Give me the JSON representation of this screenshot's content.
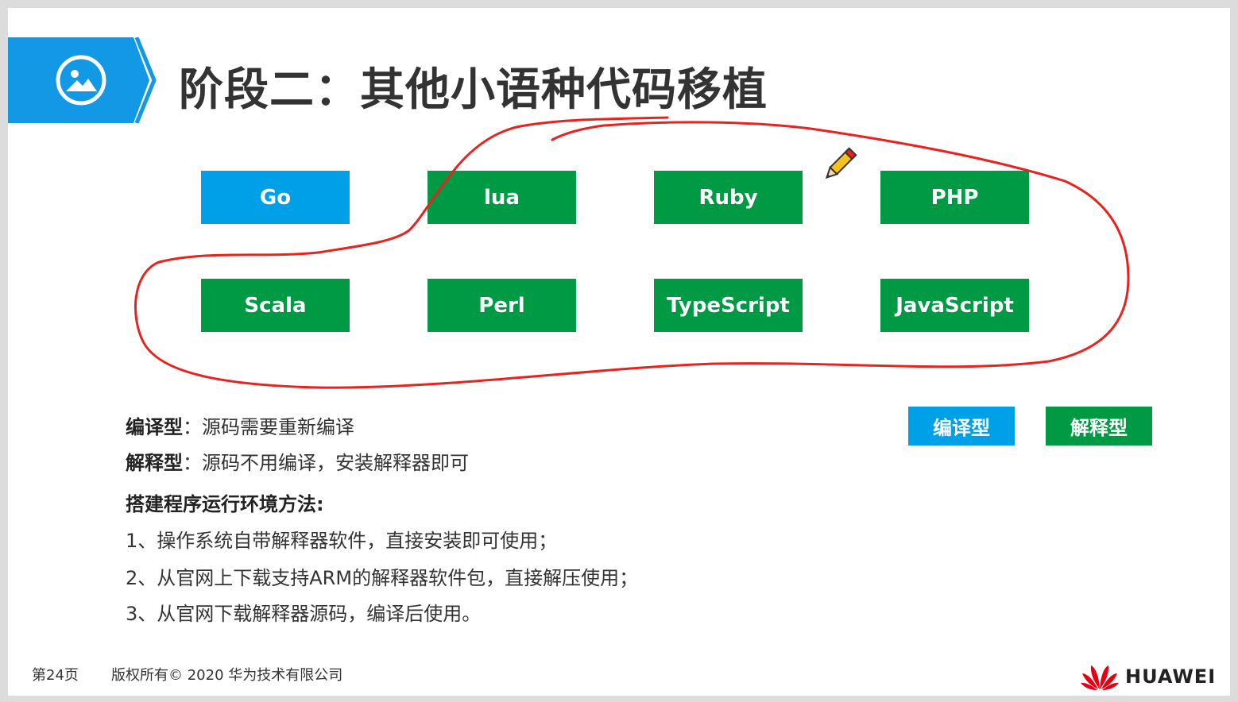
{
  "slide": {
    "title": "阶段二：其他小语种代码移植",
    "languages": [
      {
        "label": "Go",
        "type": "compiled"
      },
      {
        "label": "lua",
        "type": "interpreted"
      },
      {
        "label": "Ruby",
        "type": "interpreted"
      },
      {
        "label": "PHP",
        "type": "interpreted"
      },
      {
        "label": "Scala",
        "type": "interpreted"
      },
      {
        "label": "Perl",
        "type": "interpreted"
      },
      {
        "label": "TypeScript",
        "type": "interpreted"
      },
      {
        "label": "JavaScript",
        "type": "interpreted"
      }
    ],
    "legend": {
      "compiled": "编译型",
      "interpreted": "解释型"
    },
    "body": {
      "compiled_term": "编译型",
      "compiled_desc": "：源码需要重新编译",
      "interpreted_term": "解释型",
      "interpreted_desc": "：源码不用编译，安装解释器即可",
      "methods_heading": "搭建程序运行环境方法:",
      "methods": [
        "1、操作系统自带解释器软件，直接安装即可使用；",
        "2、从官网上下载支持ARM的解释器软件包，直接解压使用；",
        "3、从官网下载解释器源码，编译后使用。"
      ]
    },
    "footer": {
      "page": "第24页",
      "copyright": "版权所有© 2020 华为技术有限公司",
      "logo_text": "HUAWEI"
    }
  },
  "colors": {
    "compiled": "#00a0e9",
    "interpreted": "#009944",
    "header_blue": "#1398e6",
    "annotation_red": "#e8231f"
  },
  "icons": {
    "header": "image-icon",
    "cursor": "pencil-icon",
    "logo": "huawei-petal-logo"
  }
}
